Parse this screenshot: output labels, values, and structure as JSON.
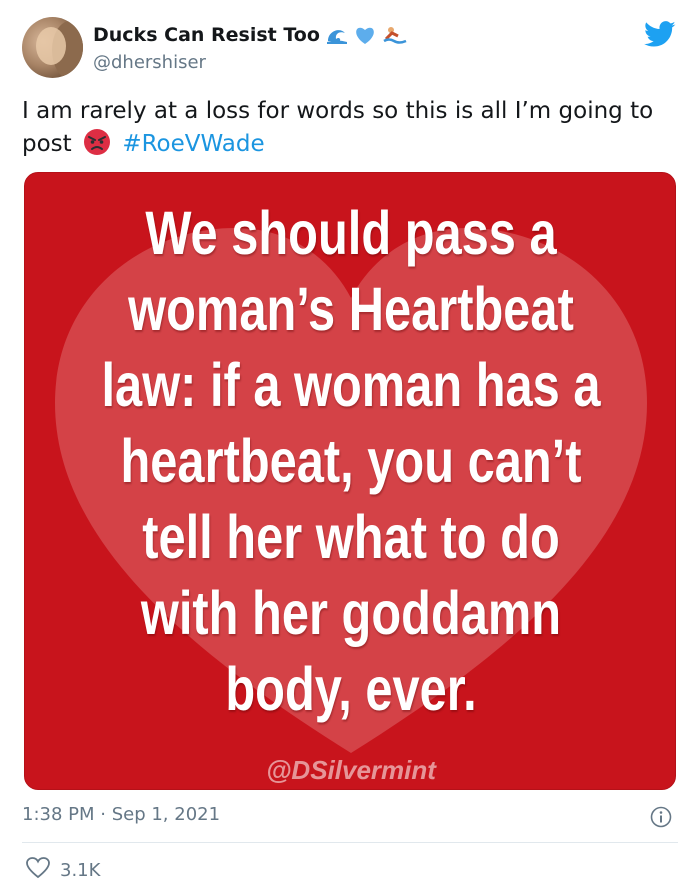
{
  "author": {
    "display_name": "Ducks Can Resist Too",
    "handle": "@dhershiser",
    "badges": [
      "wave-icon",
      "blue-heart-icon",
      "swimmer-icon"
    ]
  },
  "tweet": {
    "text_before": "I am rarely at a loss for words so this is all I’m going to post",
    "emoji": "angry-face-icon",
    "hashtag": "#RoeVWade"
  },
  "media": {
    "lines": [
      "We should pass a",
      "woman’s Heartbeat",
      "law: if a woman has a",
      "heartbeat, you can’t",
      "tell her what to do",
      "with her goddamn",
      "body, ever."
    ],
    "watermark": "@DSilvermint",
    "background_color": "#c8141c"
  },
  "footer": {
    "timestamp": "1:38 PM · Sep 1, 2021",
    "likes": "3.1K"
  },
  "colors": {
    "accent": "#1b95e0",
    "muted": "#657786"
  }
}
